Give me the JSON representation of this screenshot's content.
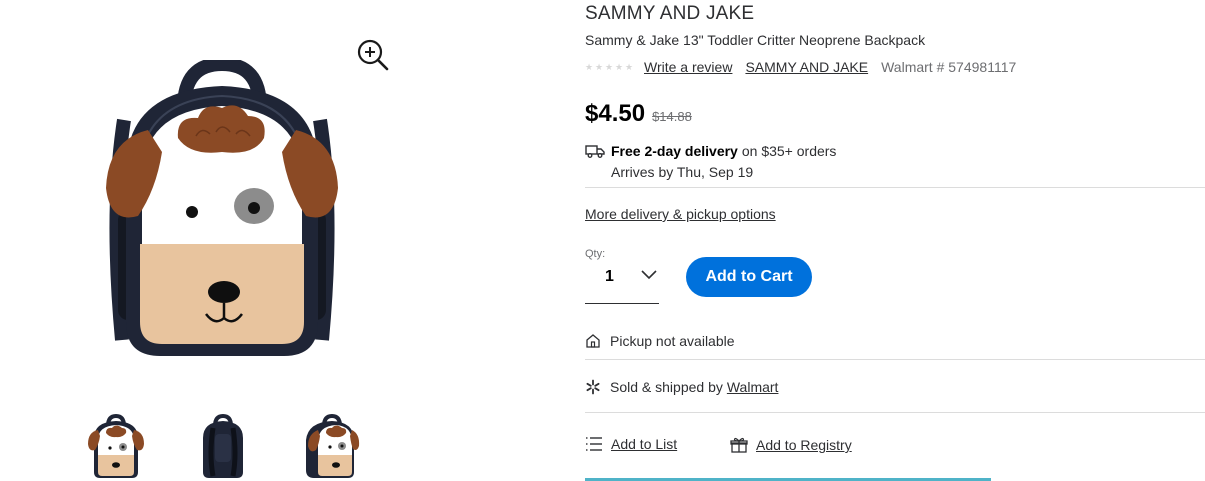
{
  "product": {
    "brand_heading": "SAMMY AND JAKE",
    "name": "Sammy & Jake 13\" Toddler Critter Neoprene Backpack",
    "rating": {
      "stars": 0,
      "max": 5
    },
    "write_review_label": "Write a review",
    "brand_link_label": "SAMMY AND JAKE",
    "item_number": "Walmart # 574981117"
  },
  "pricing": {
    "current": "$4.50",
    "was": "$14.88"
  },
  "delivery": {
    "headline_bold": "Free 2-day delivery",
    "headline_rest": "on $35+ orders",
    "arrives": "Arrives by Thu, Sep 19",
    "more_options_label": "More delivery & pickup options"
  },
  "purchase": {
    "qty_label": "Qty:",
    "qty_value": "1",
    "add_to_cart_label": "Add to Cart"
  },
  "fulfillment": {
    "pickup_text": "Pickup not available",
    "sold_by_prefix": "Sold & shipped by",
    "seller_name": "Walmart"
  },
  "actions": {
    "add_to_list_label": "Add to List",
    "add_to_registry_label": "Add to Registry"
  },
  "media": {
    "icons": [
      "zoom-in-icon",
      "truck-icon",
      "chevron-down-icon",
      "home-icon",
      "walmart-spark-icon",
      "list-icon",
      "gift-icon"
    ],
    "thumbnails": [
      "thumbnail-front",
      "thumbnail-back",
      "thumbnail-side"
    ]
  },
  "colors": {
    "accent": "#0071dc",
    "text": "#2e2f32",
    "muted": "#6d6e71",
    "backpack_navy": "#1f2536",
    "backpack_brown": "#8b4a25",
    "backpack_tan": "#e8c49e"
  }
}
